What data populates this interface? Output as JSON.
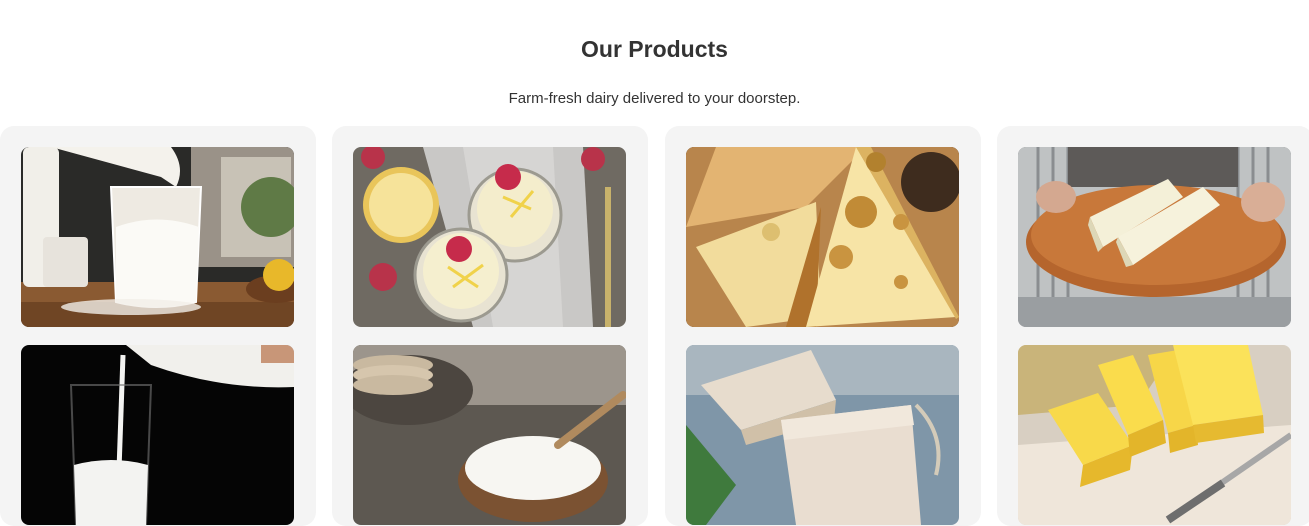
{
  "section": {
    "title": "Our Products",
    "subtitle": "Farm-fresh dairy delivered to your doorstep."
  },
  "cards": [
    {
      "images": [
        {
          "icon": "milk-glass-pour-image"
        },
        {
          "icon": "milk-pour-dark-image"
        }
      ]
    },
    {
      "images": [
        {
          "icon": "yogurt-jars-lemon-image"
        },
        {
          "icon": "yogurt-bowl-image"
        }
      ]
    },
    {
      "images": [
        {
          "icon": "swiss-cheese-image"
        },
        {
          "icon": "soap-cheese-blocks-image"
        }
      ]
    },
    {
      "images": [
        {
          "icon": "butter-board-image"
        },
        {
          "icon": "butter-blocks-image"
        }
      ]
    }
  ]
}
